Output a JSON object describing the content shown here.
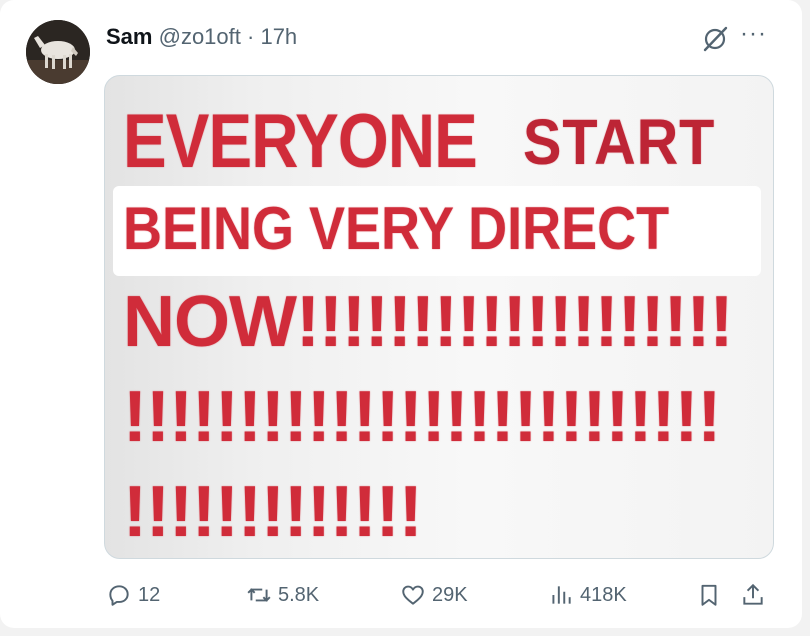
{
  "tweet": {
    "author_name": "Sam",
    "handle": "@zo1oft",
    "separator": "·",
    "time": "17h",
    "more_label": "···"
  },
  "image": {
    "line1_a": "EVERYONE",
    "line1_b": "START",
    "line2": "BEING VERY DIRECT",
    "line3": "NOW!!!!!!!!!!!!!!!!!!!",
    "line4": "!!!!!!!!!!!!!!!!!!!!!!!!!!",
    "line5": "!!!!!!!!!!!!!"
  },
  "actions": {
    "replies": "12",
    "reposts": "5.8K",
    "likes": "29K",
    "views": "418K"
  },
  "colors": {
    "meme_red": "#d02c3a",
    "secondary_text": "#536471",
    "border": "#cfd9de"
  },
  "icons": [
    "grok-icon",
    "more-icon",
    "reply-icon",
    "repost-icon",
    "like-icon",
    "views-icon",
    "bookmark-icon",
    "share-icon"
  ]
}
